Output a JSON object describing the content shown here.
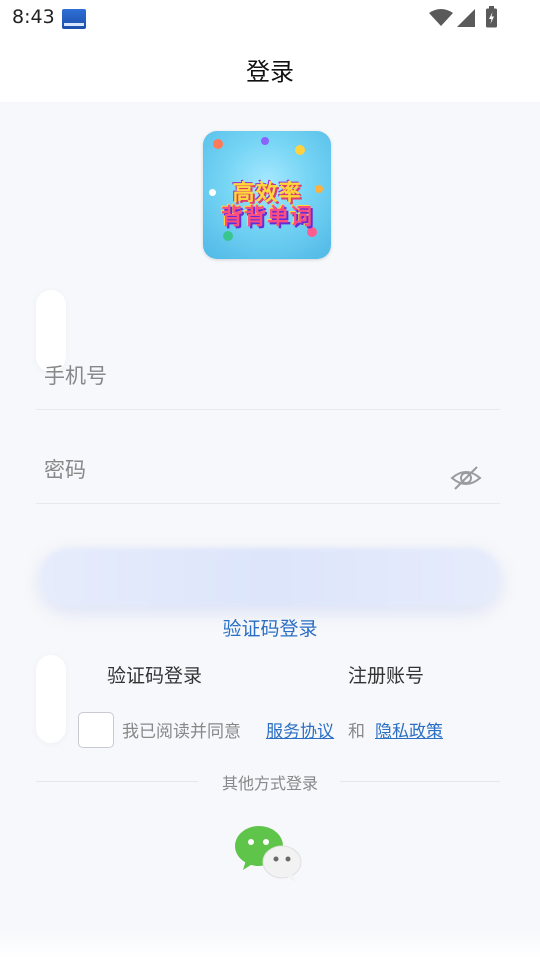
{
  "status_bar": {
    "time": "8:43"
  },
  "header": {
    "title": "登录"
  },
  "logo": {
    "line1": "高效率",
    "line2": "背背单词"
  },
  "form": {
    "phone_placeholder": "手机号",
    "password_placeholder": "密码"
  },
  "links": {
    "verify_login_center": "验证码登录",
    "verify_login_option": "验证码登录",
    "register": "注册账号"
  },
  "agreement": {
    "prefix": "我已阅读并同意",
    "service": "服务协议",
    "and": "和",
    "privacy": "隐私政策"
  },
  "other_login": {
    "label": "其他方式登录"
  },
  "icons": {
    "wechat": "wechat-icon",
    "eye_off": "eye-off-icon"
  },
  "colors": {
    "link": "#2a6fc4",
    "wechat_green": "#5ec44a"
  }
}
